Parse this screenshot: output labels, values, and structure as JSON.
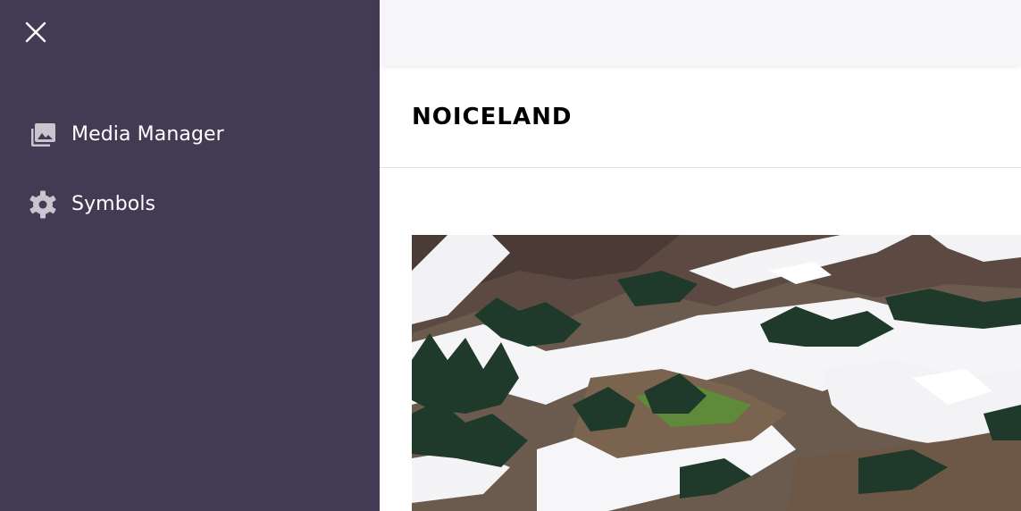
{
  "sidebar": {
    "items": [
      {
        "label": "Media Manager",
        "icon": "photo-library-icon"
      },
      {
        "label": "Symbols",
        "icon": "gear-icon"
      }
    ],
    "close_icon": "close-icon"
  },
  "header": {
    "title": "NOICELAND"
  },
  "colors": {
    "sidebar_bg": "#433b53",
    "icon": "#c8c5cf",
    "topbar_bg": "#f6f6f8"
  }
}
